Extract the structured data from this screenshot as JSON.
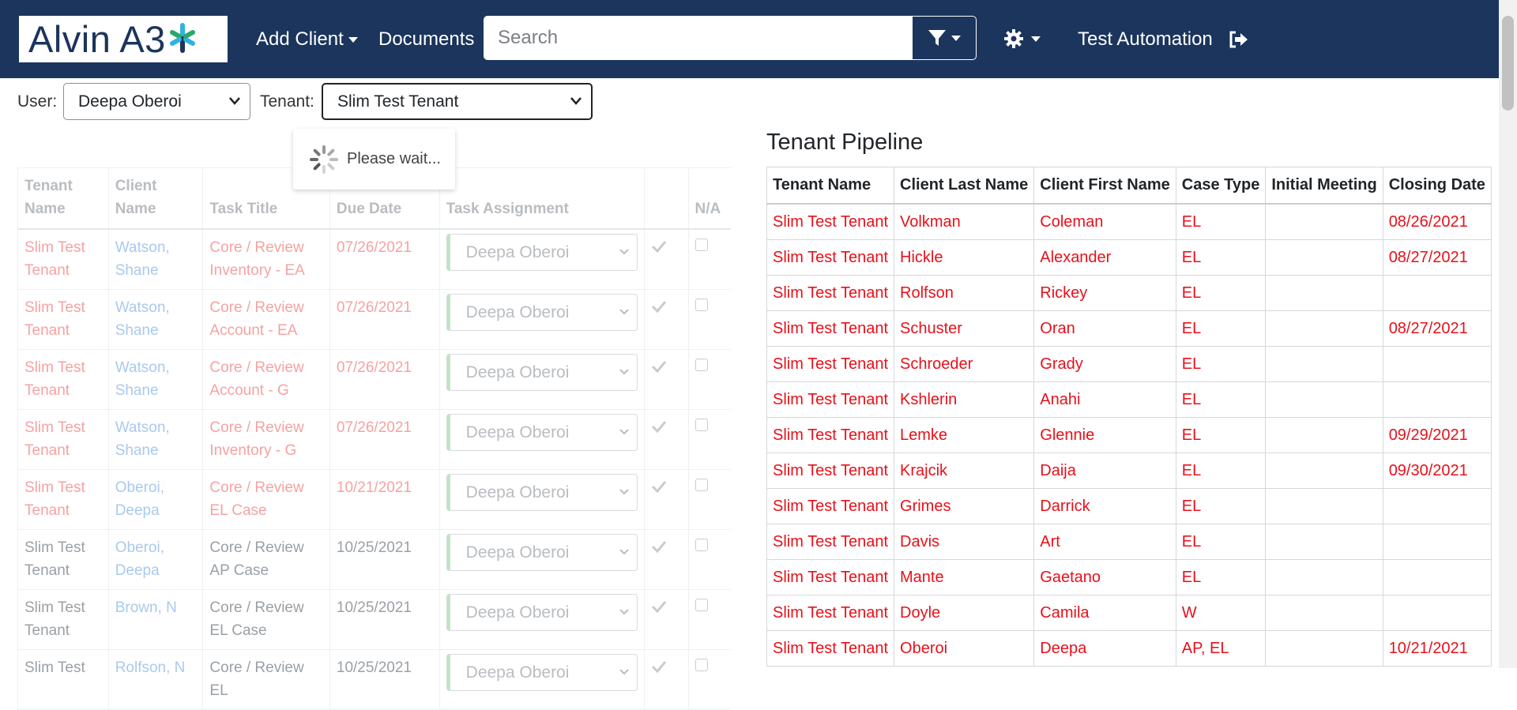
{
  "nav": {
    "logo_text": "Alvin A3",
    "add_client": "Add Client",
    "documents": "Documents",
    "search_placeholder": "Search",
    "user_name": "Test Automation",
    "bg_color": "#1b355c"
  },
  "filters": {
    "user_label": "User:",
    "user_value": "Deepa Oberoi",
    "tenant_label": "Tenant:",
    "tenant_value": "Slim Test Tenant"
  },
  "loading": {
    "text": "Please wait..."
  },
  "tasks": {
    "headers": [
      "Tenant Name",
      "Client Name",
      "Task Title",
      "Due Date",
      "Task Assignment",
      "",
      "N/A"
    ],
    "rows": [
      {
        "tenant": "Slim Test Tenant",
        "client": "Watson, Shane",
        "title": "Core / Review Inventory - EA",
        "due": "07/26/2021",
        "assign": "Deepa Oberoi",
        "overdue": true
      },
      {
        "tenant": "Slim Test Tenant",
        "client": "Watson, Shane",
        "title": "Core / Review Account - EA",
        "due": "07/26/2021",
        "assign": "Deepa Oberoi",
        "overdue": true
      },
      {
        "tenant": "Slim Test Tenant",
        "client": "Watson, Shane",
        "title": "Core / Review Account - G",
        "due": "07/26/2021",
        "assign": "Deepa Oberoi",
        "overdue": true
      },
      {
        "tenant": "Slim Test Tenant",
        "client": "Watson, Shane",
        "title": "Core / Review Inventory - G",
        "due": "07/26/2021",
        "assign": "Deepa Oberoi",
        "overdue": true
      },
      {
        "tenant": "Slim Test Tenant",
        "client": "Oberoi, Deepa",
        "title": "Core / Review EL Case",
        "due": "10/21/2021",
        "assign": "Deepa Oberoi",
        "overdue": true
      },
      {
        "tenant": "Slim Test Tenant",
        "client": "Oberoi, Deepa",
        "title": "Core / Review AP Case",
        "due": "10/25/2021",
        "assign": "Deepa Oberoi",
        "overdue": false
      },
      {
        "tenant": "Slim Test Tenant",
        "client": "Brown, N",
        "title": "Core / Review EL Case",
        "due": "10/25/2021",
        "assign": "Deepa Oberoi",
        "overdue": false
      },
      {
        "tenant": "Slim Test",
        "client": "Rolfson, N",
        "title": "Core / Review EL",
        "due": "10/25/2021",
        "assign": "Deepa Oberoi",
        "overdue": false
      }
    ]
  },
  "pipeline": {
    "title": "Tenant Pipeline",
    "headers": [
      "Tenant Name",
      "Client Last Name",
      "Client First Name",
      "Case Type",
      "Initial Meeting",
      "Closing Date"
    ],
    "rows": [
      [
        "Slim Test Tenant",
        "Volkman",
        "Coleman",
        "EL",
        "",
        "08/26/2021"
      ],
      [
        "Slim Test Tenant",
        "Hickle",
        "Alexander",
        "EL",
        "",
        "08/27/2021"
      ],
      [
        "Slim Test Tenant",
        "Rolfson",
        "Rickey",
        "EL",
        "",
        ""
      ],
      [
        "Slim Test Tenant",
        "Schuster",
        "Oran",
        "EL",
        "",
        "08/27/2021"
      ],
      [
        "Slim Test Tenant",
        "Schroeder",
        "Grady",
        "EL",
        "",
        ""
      ],
      [
        "Slim Test Tenant",
        "Kshlerin",
        "Anahi",
        "EL",
        "",
        ""
      ],
      [
        "Slim Test Tenant",
        "Lemke",
        "Glennie",
        "EL",
        "",
        "09/29/2021"
      ],
      [
        "Slim Test Tenant",
        "Krajcik",
        "Daija",
        "EL",
        "",
        "09/30/2021"
      ],
      [
        "Slim Test Tenant",
        "Grimes",
        "Darrick",
        "EL",
        "",
        ""
      ],
      [
        "Slim Test Tenant",
        "Davis",
        "Art",
        "EL",
        "",
        ""
      ],
      [
        "Slim Test Tenant",
        "Mante",
        "Gaetano",
        "EL",
        "",
        ""
      ],
      [
        "Slim Test Tenant",
        "Doyle",
        "Camila",
        "W",
        "",
        ""
      ],
      [
        "Slim Test Tenant",
        "Oberoi",
        "Deepa",
        "AP, EL",
        "",
        "10/21/2021"
      ]
    ],
    "text_color": "#e8101a"
  }
}
